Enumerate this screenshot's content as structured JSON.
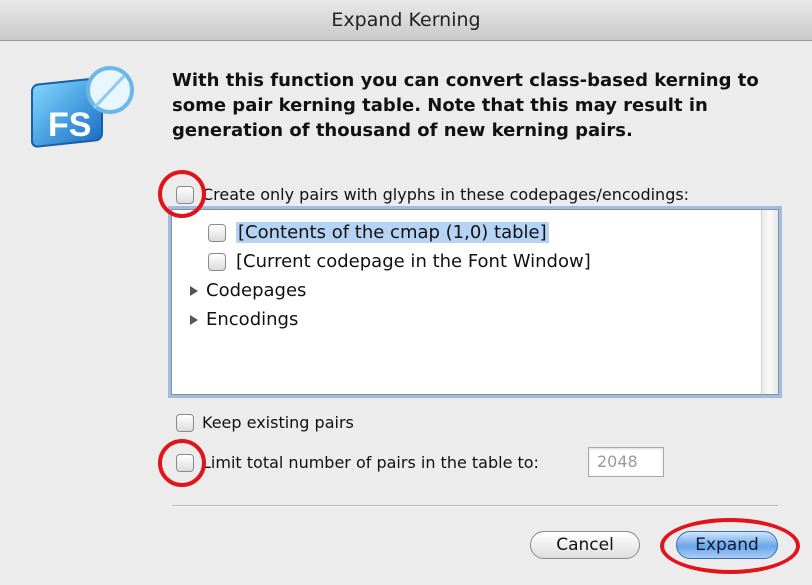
{
  "window": {
    "title": "Expand Kerning"
  },
  "intro": {
    "text": "With this function you can convert class-based kerning to some pair kerning table. Note that this may result in generation of thousand of new kerning pairs."
  },
  "logo": {
    "text": "FS"
  },
  "options": {
    "codepages_checkbox_label": "Create only pairs with glyphs in these codepages/encodings:",
    "keep_existing_label": "Keep existing pairs",
    "limit_label": "Limit total number of pairs in the table to:",
    "limit_value": "2048"
  },
  "list": {
    "items": [
      {
        "label": "[Contents of the cmap (1,0) table]"
      },
      {
        "label": "[Current codepage in the Font Window]"
      }
    ],
    "groups": [
      {
        "label": "Codepages"
      },
      {
        "label": "Encodings"
      }
    ]
  },
  "buttons": {
    "cancel": "Cancel",
    "expand": "Expand"
  },
  "colors": {
    "highlight_ring": "#e0141a",
    "selection": "#b5d3f5",
    "default_button": "#6aa6ea"
  }
}
